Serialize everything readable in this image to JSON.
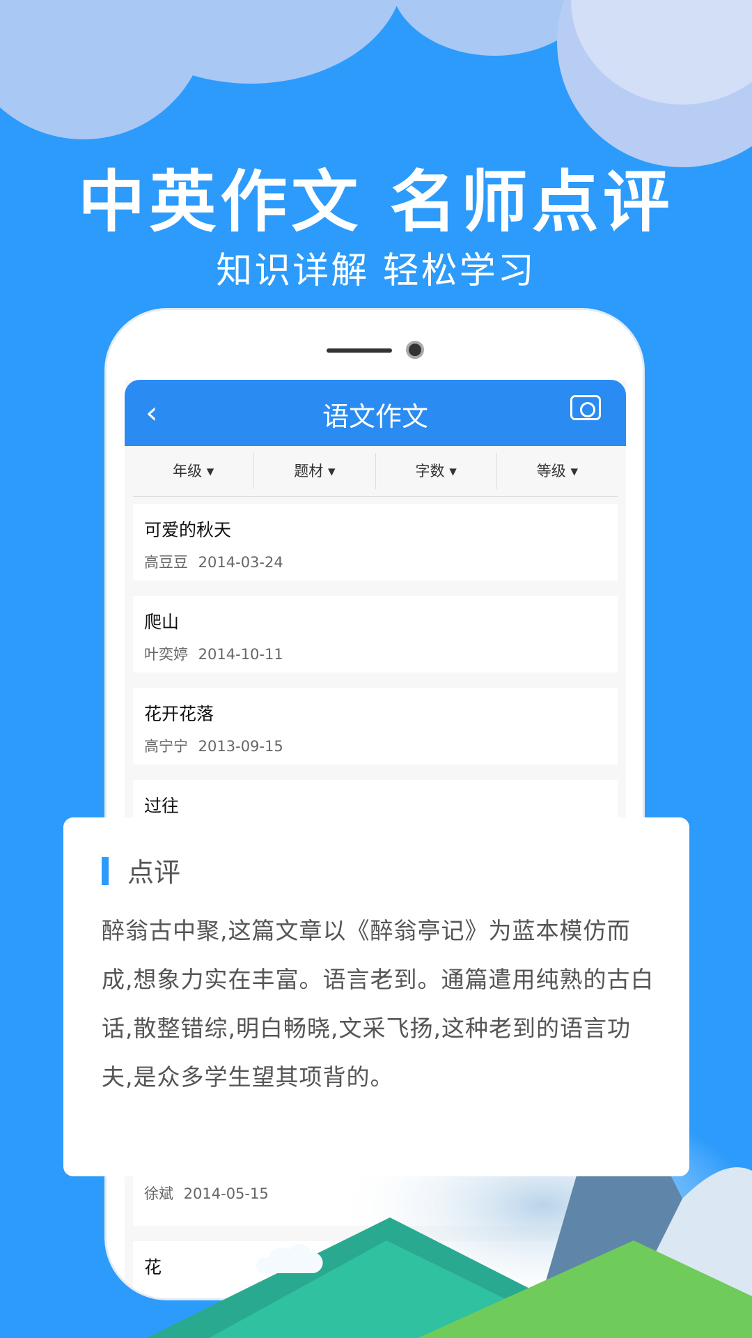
{
  "promo": {
    "headline": "中英作文 名师点评",
    "subheadline": "知识详解 轻松学习"
  },
  "app": {
    "header": {
      "title": "语文作文",
      "back_icon": "chevron-left-icon",
      "camera_icon": "camera-icon"
    },
    "filters": [
      {
        "label": "年级 ▾"
      },
      {
        "label": "题材 ▾"
      },
      {
        "label": "字数 ▾"
      },
      {
        "label": "等级 ▾"
      }
    ],
    "essays": [
      {
        "title": "可爱的秋天",
        "meta": "高豆豆 2014-03-24"
      },
      {
        "title": "爬山",
        "meta": "叶奕婷 2014-10-11"
      },
      {
        "title": "花开花落",
        "meta": "高宁宁 2013-09-15"
      },
      {
        "title": "过往",
        "meta": ""
      },
      {
        "title": "",
        "meta": "徐斌 2014-05-15"
      },
      {
        "title": "花",
        "meta": ""
      }
    ]
  },
  "review": {
    "title": "点评",
    "body": "醉翁古中聚,这篇文章以《醉翁亭记》为蓝本模仿而成,想象力实在丰富。语言老到。通篇遣用纯熟的古白话,散整错综,明白畅晓,文采飞扬,这种老到的语言功夫,是众多学生望其项背的。"
  },
  "colors": {
    "background": "#2c9bfb",
    "header": "#2a8bf2",
    "accent": "#2c9bfb"
  }
}
